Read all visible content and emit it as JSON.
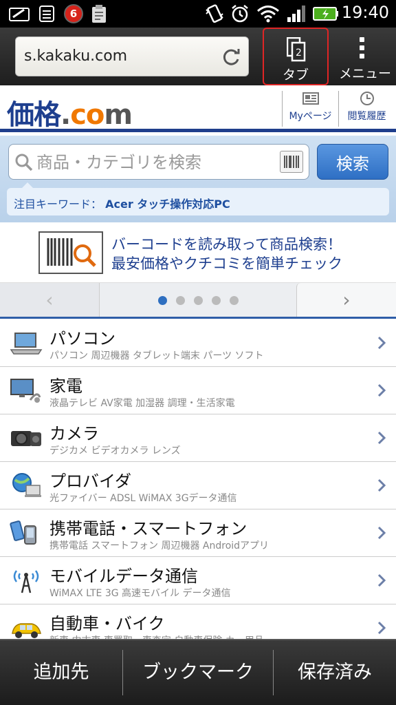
{
  "status_bar": {
    "time": "19:40",
    "notification_count": "6",
    "icons": [
      "handwriting-icon",
      "calendar-list-icon",
      "notification-count-badge",
      "clipboard-icon",
      "vibrate-icon",
      "alarm-icon",
      "wifi-icon",
      "signal-icon",
      "battery-icon"
    ]
  },
  "browser": {
    "url": "s.kakaku.com",
    "tab_label": "タブ",
    "menu_label": "メニュー"
  },
  "site": {
    "logo": {
      "kaku": "価格",
      "dot": ".",
      "co": "co",
      "m": "m"
    },
    "mypage_label": "Myページ",
    "history_label": "閲覧履歴"
  },
  "search": {
    "placeholder": "商品・カテゴリを検索",
    "button": "検索",
    "keyword_prefix": "注目キーワード：",
    "keyword": "Acer タッチ操作対応PC"
  },
  "banner": {
    "line1": "バーコードを読み取って商品検索！",
    "line2": "最安価格やクチコミを簡単チェック"
  },
  "pager": {
    "prev": "‹",
    "next": "›",
    "active_index": 0,
    "total": 5
  },
  "categories": [
    {
      "title": "パソコン",
      "sub": "パソコン 周辺機器 タブレット端末 パーツ ソフト",
      "icon": "laptop-icon"
    },
    {
      "title": "家電",
      "sub": "液晶テレビ AV家電 加湿器 調理・生活家電",
      "icon": "appliance-icon"
    },
    {
      "title": "カメラ",
      "sub": "デジカメ ビデオカメラ レンズ",
      "icon": "camera-icon"
    },
    {
      "title": "プロバイダ",
      "sub": "光ファイバー ADSL WiMAX 3Gデータ通信",
      "icon": "globe-computer-icon"
    },
    {
      "title": "携帯電話・スマートフォン",
      "sub": "携帯電話 スマートフォン 周辺機器 Androidアプリ",
      "icon": "mobile-phone-icon"
    },
    {
      "title": "モバイルデータ通信",
      "sub": "WiMAX LTE 3G 高速モバイル データ通信",
      "icon": "antenna-icon"
    },
    {
      "title": "自動車・バイク",
      "sub": "新車 中古車 車買取・車査定 自動車保険 カー用品",
      "icon": "car-icon"
    }
  ],
  "bottom_bar": {
    "add_to": "追加先",
    "bookmark": "ブックマーク",
    "saved": "保存済み"
  },
  "colors": {
    "brand_blue": "#1e3f8f",
    "brand_orange": "#f07800",
    "highlight_red": "#e02525"
  }
}
